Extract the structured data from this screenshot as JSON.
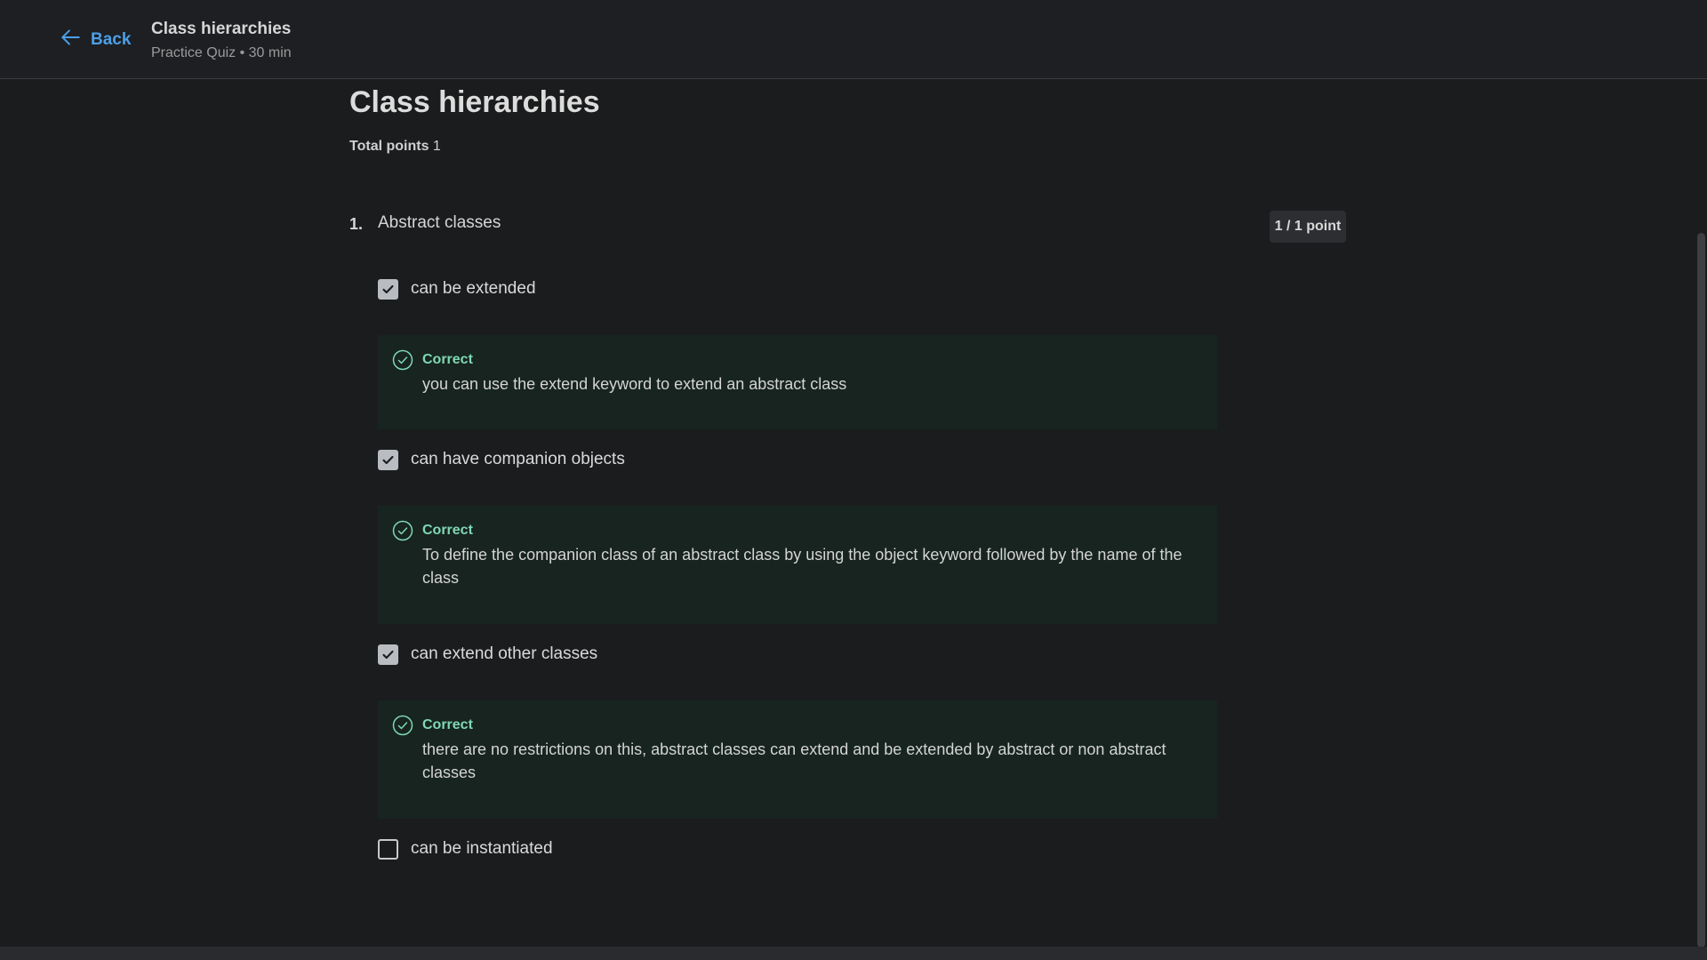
{
  "header": {
    "back_label": "Back",
    "title": "Class hierarchies",
    "subtitle": "Practice Quiz • 30 min"
  },
  "quiz": {
    "title": "Class hierarchies",
    "total_points_label": "Total points",
    "total_points_value": "1"
  },
  "question": {
    "number": "1.",
    "text": "Abstract classes",
    "score": "1 / 1 point",
    "options": [
      {
        "label": "can be extended",
        "checked": true,
        "feedback_status": "Correct",
        "feedback_text": "you can use the extend keyword to extend an abstract class"
      },
      {
        "label": "can have companion objects",
        "checked": true,
        "feedback_status": "Correct",
        "feedback_text": "To define the companion class of an abstract class by using the object keyword followed by the name of the class"
      },
      {
        "label": "can extend other classes",
        "checked": true,
        "feedback_status": "Correct",
        "feedback_text": "there are no restrictions on this, abstract classes can extend and be extended by abstract or non abstract classes"
      },
      {
        "label": "can be instantiated",
        "checked": false
      }
    ]
  },
  "colors": {
    "accent": "#4c9fe8",
    "correct": "#7fd8b4",
    "feedback_bg": "#172420",
    "background": "#1b1c1e"
  },
  "icons": {
    "back": "arrow-left-icon",
    "checkbox_checked": "checkmark-icon",
    "feedback": "check-circle-icon"
  }
}
